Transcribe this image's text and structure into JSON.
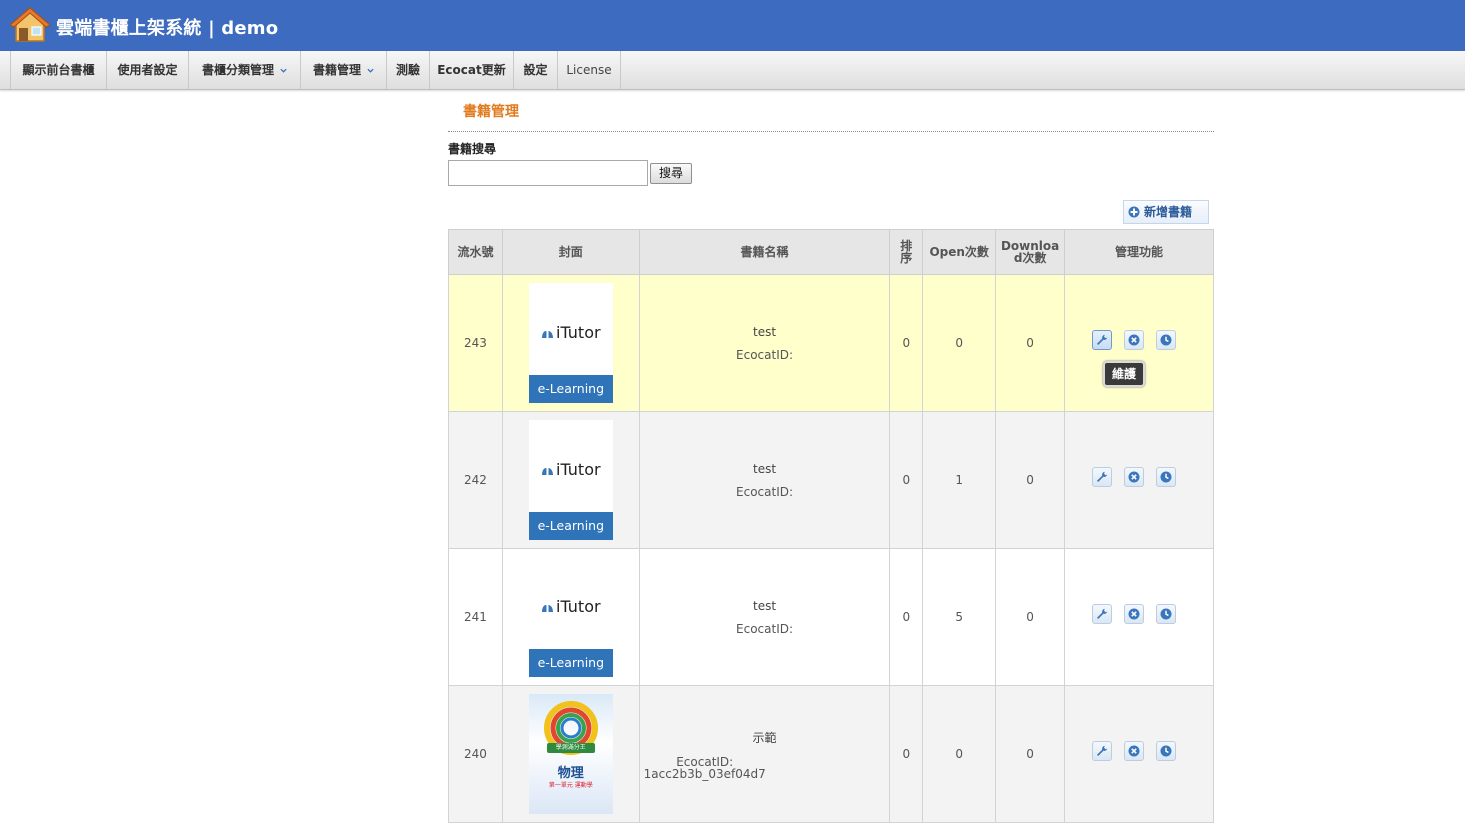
{
  "header": {
    "title": "雲端書櫃上架系統 | demo",
    "logo_icon": "house-icon"
  },
  "nav": {
    "items": [
      {
        "label": "顯示前台書櫃"
      },
      {
        "label": "使用者設定"
      },
      {
        "label": "書櫃分類管理"
      },
      {
        "label": "書籍管理"
      },
      {
        "label": "測驗"
      },
      {
        "label": "Ecocat更新"
      },
      {
        "label": "設定"
      },
      {
        "label": "License"
      }
    ]
  },
  "page": {
    "title": "書籍管理"
  },
  "search": {
    "label": "書籍搜尋",
    "value": "",
    "button_label": "搜尋"
  },
  "add_book": {
    "label": "新增書籍"
  },
  "table": {
    "headers": {
      "serial": "流水號",
      "cover": "封面",
      "name": "書籍名稱",
      "order": "排序",
      "open": "Open次數",
      "download": "Download次數",
      "manage": "管理功能"
    },
    "rows": [
      {
        "id": "243",
        "cover_brand": "iTutor",
        "cover_band": "e-Learning",
        "name": "test",
        "ecocat": "EcocatID:",
        "order": "0",
        "open": "0",
        "download": "0"
      },
      {
        "id": "242",
        "cover_brand": "iTutor",
        "cover_band": "e-Learning",
        "name": "test",
        "ecocat": "EcocatID:",
        "order": "0",
        "open": "1",
        "download": "0"
      },
      {
        "id": "241",
        "cover_brand": "iTutor",
        "cover_band": "e-Learning",
        "name": "test",
        "ecocat": "EcocatID:",
        "order": "0",
        "open": "5",
        "download": "0"
      },
      {
        "id": "240",
        "cover_title": "物理",
        "cover_tag": "學測滿分王",
        "cover_sub": "第一單元 運動學",
        "name": "示範",
        "ecocat": "EcocatID: 1acc2b3b_03ef04d7",
        "order": "0",
        "open": "0",
        "download": "0"
      }
    ]
  },
  "tooltip": {
    "text": "維護"
  },
  "colors": {
    "header_bg": "#3c6bc0",
    "title_accent": "#e07b20",
    "highlight_row": "#ffffcc",
    "cover_band": "#2f74b8"
  }
}
